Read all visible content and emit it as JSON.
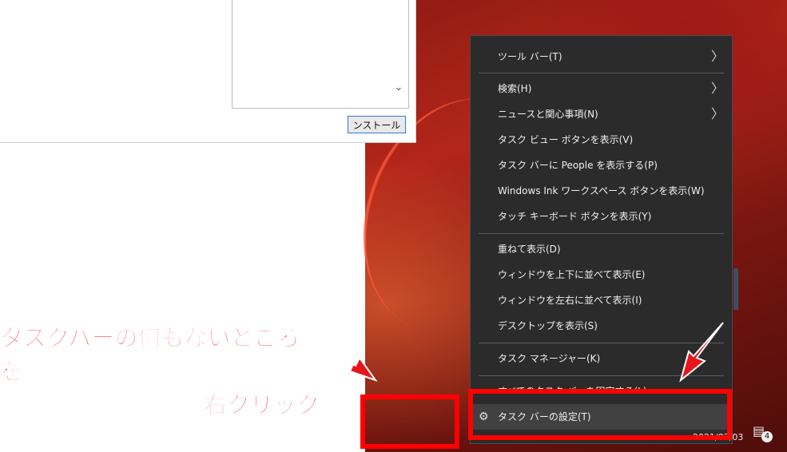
{
  "installer": {
    "install_button_label": "ンストール",
    "scroll_arrow": "⌄"
  },
  "menu": {
    "items": [
      {
        "label": "ツール バー(T)",
        "submenu": true
      },
      {
        "label": "検索(H)",
        "submenu": true
      },
      {
        "label": "ニュースと関心事項(N)",
        "submenu": true
      },
      {
        "label": "タスク ビュー ボタンを表示(V)",
        "submenu": false
      },
      {
        "label": "タスク バーに People を表示する(P)",
        "submenu": false
      },
      {
        "label": "Windows Ink ワークスペース ボタンを表示(W)",
        "submenu": false
      },
      {
        "label": "タッチ キーボード ボタンを表示(Y)",
        "submenu": false
      },
      {
        "label": "重ねて表示(D)",
        "submenu": false
      },
      {
        "label": "ウィンドウを上下に並べて表示(E)",
        "submenu": false
      },
      {
        "label": "ウィンドウを左右に並べて表示(I)",
        "submenu": false
      },
      {
        "label": "デスクトップを表示(S)",
        "submenu": false
      },
      {
        "label": "タスク マネージャー(K)",
        "submenu": false
      },
      {
        "label": "すべてのタスク バーを固定する(L)",
        "submenu": false
      },
      {
        "label": "タスク バーの設定(T)",
        "submenu": false,
        "icon": "gear-icon"
      }
    ],
    "chevron": "〉"
  },
  "taskbar": {
    "clock_date": "2021/07/03",
    "notification_count": "4",
    "notification_icon": "message-icon"
  },
  "annotation": {
    "line1": "タスクバーの何もないところを",
    "line2": "右クリック",
    "color": "#e8141b"
  }
}
